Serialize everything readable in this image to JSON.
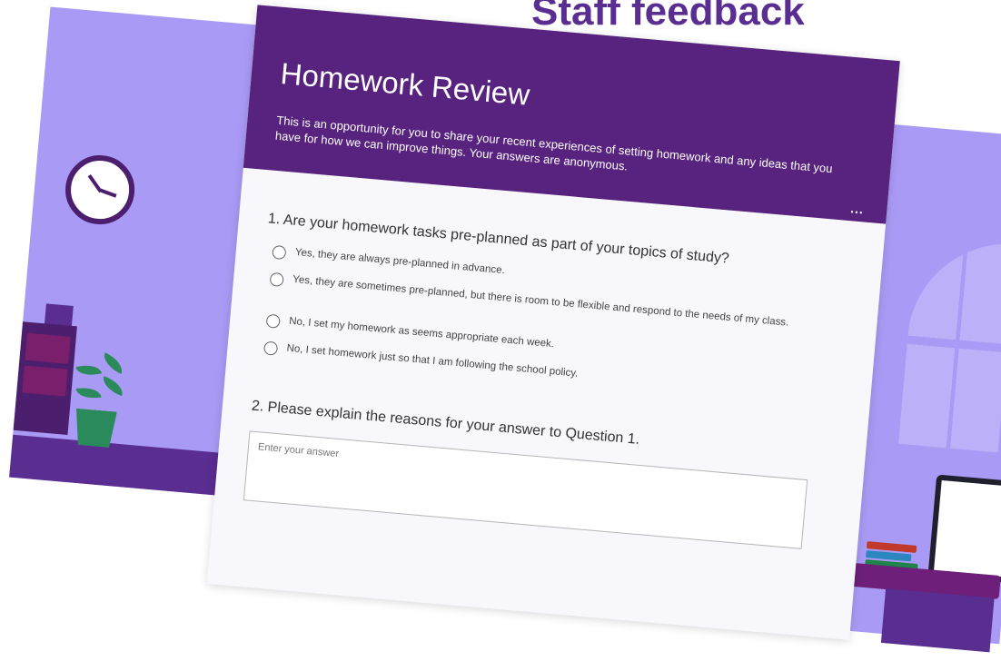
{
  "slide": {
    "title": "Staff feedback"
  },
  "form": {
    "title": "Homework Review",
    "description": "This is an opportunity for you to share your recent experiences of setting homework and any ideas that you have for how we can improve things. Your answers are anonymous.",
    "more_label": "...",
    "q1": {
      "label": "1. Are your homework tasks pre-planned as part of your topics of study?",
      "options": [
        "Yes, they are always pre-planned in advance.",
        "Yes, they are sometimes pre-planned, but there is room to be flexible and respond to the needs of my class.",
        "No, I set my homework as seems appropriate each week.",
        "No, I set homework just so that I am following the school policy."
      ]
    },
    "q2": {
      "label": "2. Please explain the reasons for your answer to Question 1.",
      "placeholder": "Enter your answer"
    }
  },
  "colors": {
    "header": "#57237e",
    "background_accent": "#a99af5",
    "title_accent": "#5a2d91"
  }
}
